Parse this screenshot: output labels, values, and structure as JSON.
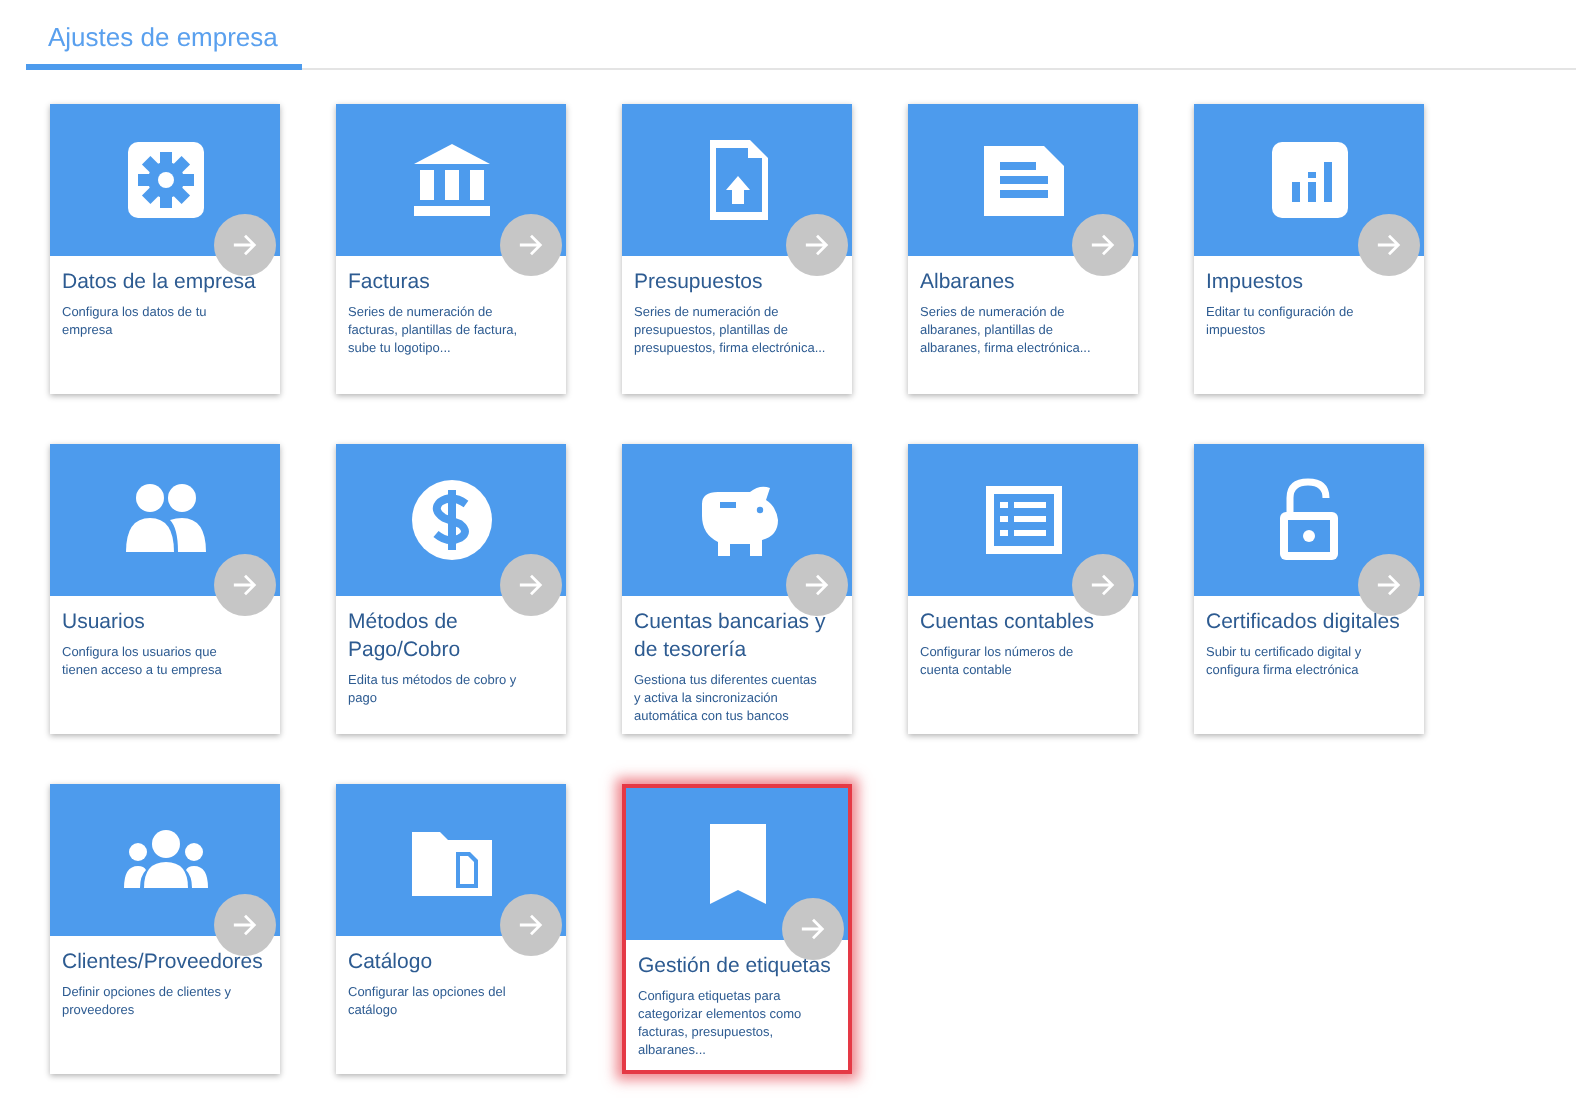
{
  "tabs": [
    {
      "label": "Ajustes de empresa",
      "selected": true
    }
  ],
  "cards": [
    {
      "kind": "gear",
      "title": "Datos de la empresa",
      "description": "Configura los datos de tu empresa",
      "highlighted": false
    },
    {
      "kind": "bank",
      "title": "Facturas",
      "description": "Series de numeración de facturas, plantillas de factura, sube tu logotipo...",
      "highlighted": false
    },
    {
      "kind": "upload",
      "title": "Presupuestos",
      "description": "Series de numeración de presupuestos, plantillas de presupuestos, firma electrónica...",
      "highlighted": false
    },
    {
      "kind": "document",
      "title": "Albaranes",
      "description": "Series de numeración de albaranes, plantillas de albaranes, firma electrónica...",
      "highlighted": false
    },
    {
      "kind": "chart",
      "title": "Impuestos",
      "description": "Editar tu configuración de impuestos",
      "highlighted": false
    },
    {
      "kind": "users",
      "title": "Usuarios",
      "description": "Configura los usuarios que tienen acceso a tu empresa",
      "highlighted": false
    },
    {
      "kind": "dollar",
      "title": "Métodos de Pago/Cobro",
      "description": "Edita tus métodos de cobro y pago",
      "highlighted": false
    },
    {
      "kind": "piggy",
      "title": "Cuentas bancarias y de tesorería",
      "description": "Gestiona tus diferentes cuentas y activa la sincronización automática con tus bancos",
      "highlighted": false
    },
    {
      "kind": "list",
      "title": "Cuentas contables",
      "description": "Configurar los números de cuenta contable",
      "highlighted": false
    },
    {
      "kind": "lock",
      "title": "Certificados digitales",
      "description": "Subir tu certificado digital y configura firma electrónica",
      "highlighted": false
    },
    {
      "kind": "group",
      "title": "Clientes/Proveedores",
      "description": "Definir opciones de clientes y proveedores",
      "highlighted": false
    },
    {
      "kind": "folder",
      "title": "Catálogo",
      "description": "Configurar las opciones del catálogo",
      "highlighted": false
    },
    {
      "kind": "bookmark",
      "title": "Gestión de etiquetas",
      "description": "Configura etiquetas para categorizar elementos como facturas, presupuestos, albaranes...",
      "highlighted": true
    }
  ]
}
